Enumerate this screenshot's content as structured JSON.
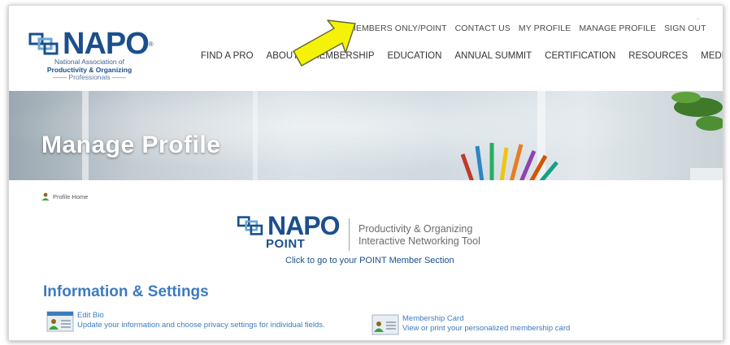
{
  "logo": {
    "word": "NAPO",
    "reg": "®",
    "sub_line1": "National Association of",
    "sub_line2": "Productivity & Organizing",
    "sub_line3": "Professionals"
  },
  "util_nav": [
    "MEMBERS ONLY/POINT",
    "CONTACT US",
    "MY PROFILE",
    "MANAGE PROFILE",
    "SIGN OUT"
  ],
  "main_nav": [
    "FIND A PRO",
    "ABOUT",
    "MEMBERSHIP",
    "EDUCATION",
    "ANNUAL SUMMIT",
    "CERTIFICATION",
    "RESOURCES",
    "MEDIA"
  ],
  "banner": {
    "title": "Manage Profile"
  },
  "breadcrumb": {
    "label": "Profile Home"
  },
  "point": {
    "word": "NAPO",
    "sub": "POINT",
    "tag_line1": "Productivity & Organizing",
    "tag_line2": "Interactive Networking Tool",
    "link": "Click to go to your POINT Member Section"
  },
  "section": {
    "title": "Information & Settings"
  },
  "items": [
    {
      "title": "Edit Bio",
      "desc": "Update your information and choose privacy settings for individual fields."
    },
    {
      "title": "Membership Card",
      "desc": "View or print your personalized membership card"
    }
  ],
  "colors": {
    "brand": "#1b4f8c",
    "accent": "#3c7bbf",
    "arrow": "#f5f20a"
  }
}
